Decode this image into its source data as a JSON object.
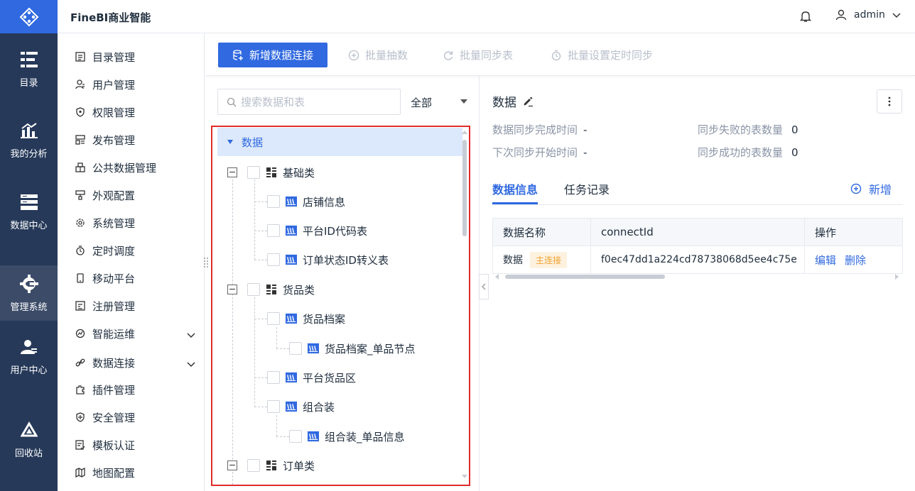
{
  "app": {
    "title": "FineBI商业智能"
  },
  "header": {
    "username": "admin"
  },
  "rail": [
    {
      "label": "目录",
      "icon": "catalog-icon"
    },
    {
      "label": "我的分析",
      "icon": "analysis-icon"
    },
    {
      "label": "数据中心",
      "icon": "data-center-icon"
    },
    {
      "label": "管理系统",
      "icon": "gear-icon",
      "active": true
    },
    {
      "label": "用户中心",
      "icon": "user-center-icon"
    },
    {
      "label": "回收站",
      "icon": "recycle-icon"
    }
  ],
  "menu": [
    {
      "label": "目录管理",
      "icon": "list-icon"
    },
    {
      "label": "用户管理",
      "icon": "user-icon"
    },
    {
      "label": "权限管理",
      "icon": "shield-icon"
    },
    {
      "label": "发布管理",
      "icon": "publish-icon"
    },
    {
      "label": "公共数据管理",
      "icon": "public-data-icon"
    },
    {
      "label": "外观配置",
      "icon": "brush-icon"
    },
    {
      "label": "系统管理",
      "icon": "settings-icon"
    },
    {
      "label": "定时调度",
      "icon": "timer-icon"
    },
    {
      "label": "移动平台",
      "icon": "mobile-icon"
    },
    {
      "label": "注册管理",
      "icon": "register-icon"
    },
    {
      "label": "智能运维",
      "icon": "ops-icon",
      "expandable": true
    },
    {
      "label": "数据连接",
      "icon": "link-icon",
      "expandable": true
    },
    {
      "label": "插件管理",
      "icon": "plugin-icon"
    },
    {
      "label": "安全管理",
      "icon": "security-icon"
    },
    {
      "label": "模板认证",
      "icon": "template-icon"
    },
    {
      "label": "地图配置",
      "icon": "map-icon"
    }
  ],
  "toolbar": {
    "new_connection": "新增数据连接",
    "batch_extract": "批量抽数",
    "batch_sync": "批量同步表",
    "batch_schedule": "批量设置定时同步"
  },
  "search": {
    "placeholder": "搜索数据和表",
    "filter": "全部"
  },
  "tree": {
    "root": "数据",
    "groups": [
      {
        "label": "基础类",
        "children": [
          "店铺信息",
          "平台ID代码表",
          "订单状态ID转义表"
        ]
      },
      {
        "label": "货品类",
        "children": [
          "货品档案",
          "货品档案_单品节点",
          "平台货品区",
          "组合装",
          "组合装_单品信息"
        ]
      },
      {
        "label": "订单类",
        "children": []
      }
    ]
  },
  "detail": {
    "title": "数据",
    "sync_done_label": "数据同步完成时间",
    "sync_done_value": "-",
    "next_sync_label": "下次同步开始时间",
    "next_sync_value": "-",
    "fail_count_label": "同步失败的表数量",
    "fail_count_value": "0",
    "success_count_label": "同步成功的表数量",
    "success_count_value": "0",
    "tabs": [
      "数据信息",
      "任务记录"
    ],
    "add_label": "新增",
    "table": {
      "headers": [
        "数据名称",
        "connectId",
        "操作"
      ],
      "rows": [
        {
          "name": "数据",
          "tag": "主连接",
          "connect_id": "f0ec47dd1a224cd78738068d5ee4c75e",
          "actions": [
            "编辑",
            "删除"
          ]
        }
      ]
    }
  },
  "colors": {
    "primary": "#3069e0",
    "rail": "#263959",
    "highlight_border": "#e02b2b",
    "tag_text": "#f0a22e"
  }
}
